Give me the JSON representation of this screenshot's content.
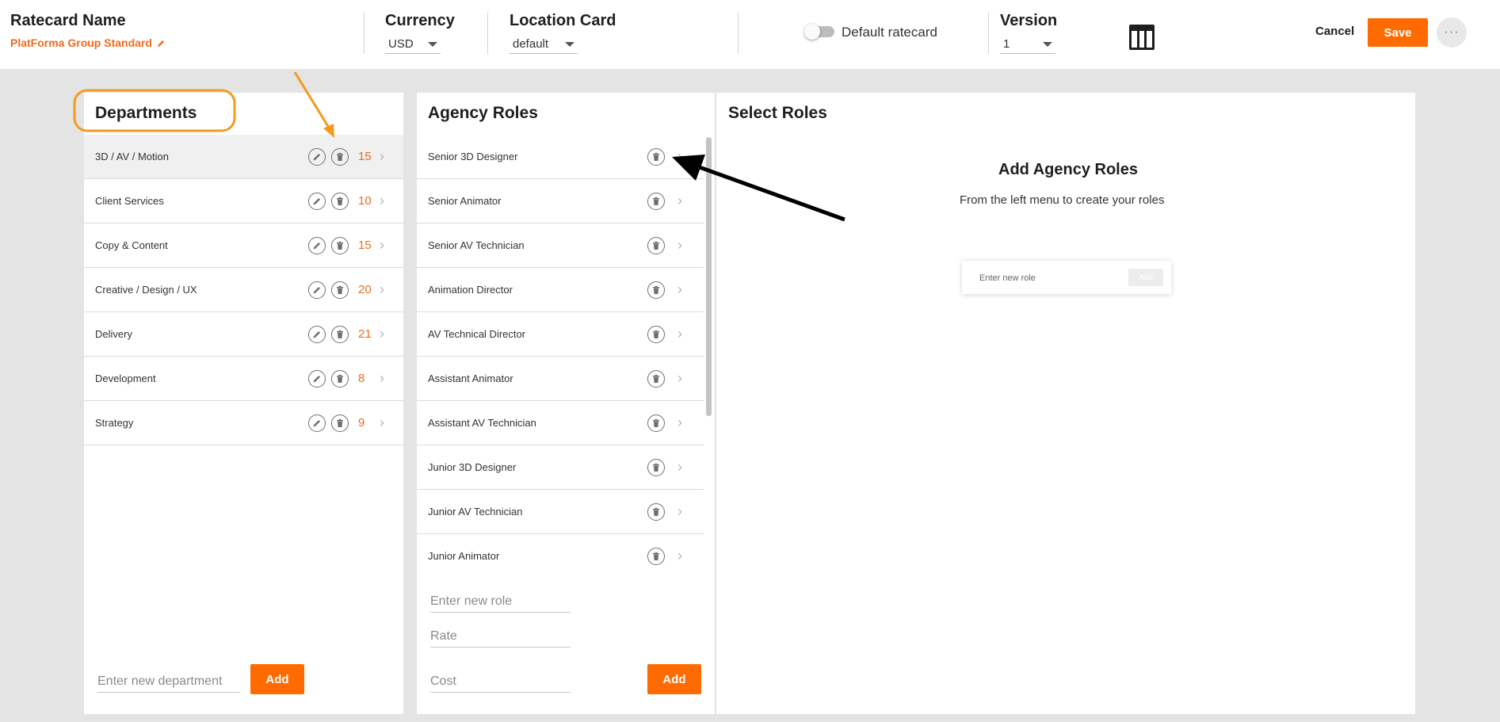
{
  "header": {
    "ratecard_label": "Ratecard Name",
    "ratecard_name": "PlatForma Group Standard",
    "currency_label": "Currency",
    "currency_value": "USD",
    "location_label": "Location Card",
    "location_value": "default",
    "default_toggle_label": "Default ratecard",
    "version_label": "Version",
    "version_value": "1",
    "cancel_label": "Cancel",
    "save_label": "Save",
    "more_label": "···"
  },
  "departments": {
    "title": "Departments",
    "items": [
      {
        "label": "3D / AV / Motion",
        "count": "15"
      },
      {
        "label": "Client Services",
        "count": "10"
      },
      {
        "label": "Copy & Content",
        "count": "15"
      },
      {
        "label": "Creative / Design / UX",
        "count": "20"
      },
      {
        "label": "Delivery",
        "count": "21"
      },
      {
        "label": "Development",
        "count": "8"
      },
      {
        "label": "Strategy",
        "count": "9"
      }
    ],
    "selected_index": 0,
    "new_placeholder": "Enter new department",
    "add_label": "Add"
  },
  "roles": {
    "title": "Agency Roles",
    "items": [
      "Senior 3D Designer",
      "Senior Animator",
      "Senior AV Technician",
      "Animation Director",
      "AV Technical Director",
      "Assistant Animator",
      "Assistant AV Technician",
      "Junior 3D Designer",
      "Junior AV Technician",
      "Junior Animator"
    ],
    "role_placeholder": "Enter new role",
    "rate_placeholder": "Rate",
    "cost_placeholder": "Cost",
    "add_label": "Add"
  },
  "select_roles": {
    "title": "Select Roles",
    "heading": "Add Agency Roles",
    "subheading": "From the left menu to create your roles",
    "illustration_input": "Enter new role",
    "illustration_button": "Add"
  },
  "colors": {
    "accent": "#ff6b00",
    "count_text": "#f26a1b",
    "annotation_orange": "#f39a1f",
    "annotation_black": "#000000"
  },
  "icons": [
    "pencil-icon",
    "trash-icon",
    "chevron-right-icon",
    "caret-down-icon",
    "table-layout-icon",
    "more-icon"
  ]
}
